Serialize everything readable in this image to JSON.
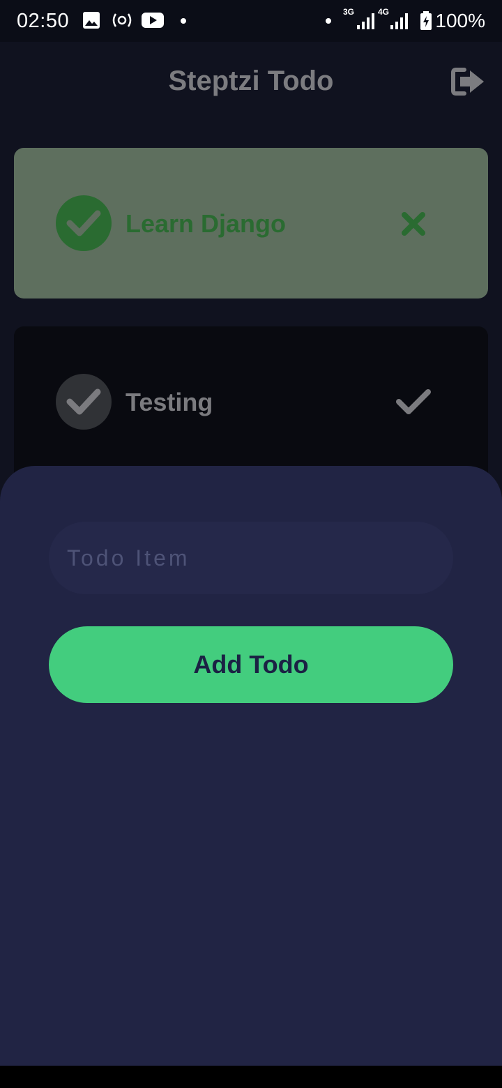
{
  "status_bar": {
    "time": "02:50",
    "network_3g": "3G",
    "network_4g": "4G",
    "battery": "100%"
  },
  "header": {
    "title": "Steptzi Todo",
    "logout_icon": "logout-icon"
  },
  "todos": [
    {
      "label": "Learn Django",
      "completed": true,
      "action_icon": "close-icon",
      "colors": {
        "card": "#5e6f5e",
        "circle": "#2a6b31",
        "text": "#2a6b31",
        "check": "#5e6f5e"
      }
    },
    {
      "label": "Testing",
      "completed": false,
      "action_icon": "check-icon",
      "colors": {
        "card": "#090a10",
        "circle": "#303236",
        "text": "#7b7b7f",
        "check": "#7b7b7f"
      }
    }
  ],
  "form": {
    "placeholder": "Todo Item",
    "button_label": "Add Todo",
    "accent": "#43cd7e"
  }
}
